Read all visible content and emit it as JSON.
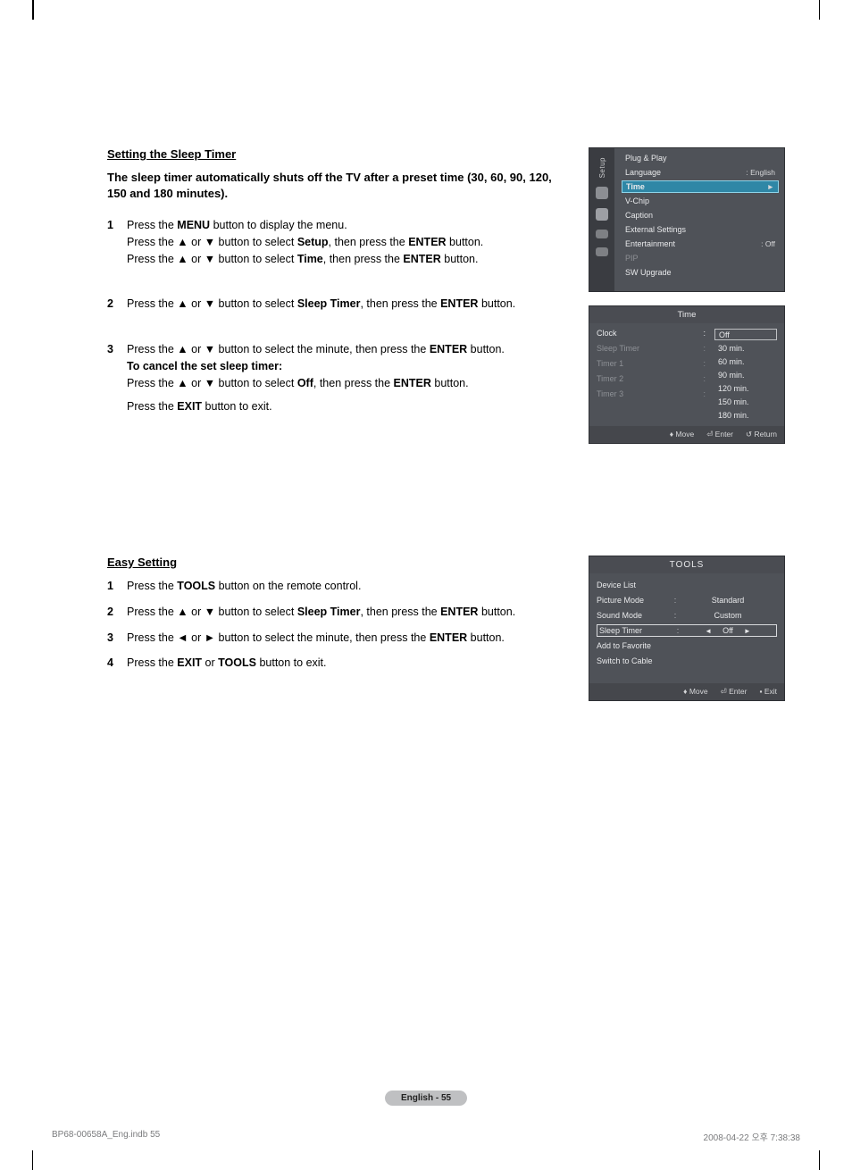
{
  "section1": {
    "heading": "Setting the Sleep Timer",
    "intro": "The sleep timer automatically shuts off the TV after a preset time (30, 60, 90, 120, 150 and 180 minutes).",
    "steps": [
      {
        "n": "1",
        "html": "Press the <b>MENU</b> button to display the menu.<br>Press the ▲ or ▼ button to select <b>Setup</b>, then press the <b>ENTER</b> button.<br>Press the ▲ or ▼ button to select <b>Time</b>, then press the <b>ENTER</b> button."
      },
      {
        "n": "2",
        "html": "Press the ▲ or ▼ button to select <b>Sleep Timer</b>, then press the <b>ENTER</b> button."
      },
      {
        "n": "3",
        "html": "Press the ▲ or ▼ button to select the minute, then press the <b>ENTER</b> button.<br><b>To cancel the set sleep timer:</b><br>Press the ▲ or ▼ button to select <b>Off</b>, then press the <b>ENTER</b> button.<br><span style='display:block;height:8px'></span>Press the <b>EXIT</b> button to exit."
      }
    ]
  },
  "section2": {
    "heading": "Easy Setting",
    "steps": [
      {
        "n": "1",
        "html": "Press the <b>TOOLS</b> button on the remote control."
      },
      {
        "n": "2",
        "html": "Press the ▲ or ▼ button to select <b>Sleep Timer</b>, then press the <b>ENTER</b> button."
      },
      {
        "n": "3",
        "html": "Press the ◄ or ► button to select the minute, then press the <b>ENTER</b> button."
      },
      {
        "n": "4",
        "html": "Press the <b>EXIT</b> or <b>TOOLS</b> button to exit."
      }
    ]
  },
  "osd_setup": {
    "rail_label": "Setup",
    "items": [
      {
        "k": "Plug & Play",
        "v": ""
      },
      {
        "k": "Language",
        "v": ": English"
      },
      {
        "k": "Time",
        "v": "►",
        "sel": true
      },
      {
        "k": "V-Chip",
        "v": ""
      },
      {
        "k": "Caption",
        "v": ""
      },
      {
        "k": "External Settings",
        "v": ""
      },
      {
        "k": "Entertainment",
        "v": ": Off"
      },
      {
        "k": "PIP",
        "v": "",
        "dim": true
      },
      {
        "k": "SW Upgrade",
        "v": ""
      }
    ]
  },
  "osd_time": {
    "title": "Time",
    "left": [
      {
        "k": "Clock",
        "v": ":",
        "on": true
      },
      {
        "k": "Sleep Timer",
        "v": ":"
      },
      {
        "k": "Timer 1",
        "v": ":"
      },
      {
        "k": "Timer 2",
        "v": ":"
      },
      {
        "k": "Timer 3",
        "v": ":"
      }
    ],
    "options": [
      "Off",
      "30 min.",
      "60 min.",
      "90 min.",
      "120 min.",
      "150 min.",
      "180 min."
    ],
    "foot": {
      "move": "Move",
      "enter": "Enter",
      "return": "Return"
    }
  },
  "osd_tools": {
    "title": "TOOLS",
    "rows": [
      {
        "k": "Device List",
        "type": "plain"
      },
      {
        "k": "Picture Mode",
        "v": "Standard"
      },
      {
        "k": "Sound Mode",
        "v": "Custom"
      },
      {
        "k": "Sleep Timer",
        "v": "Off",
        "sel": true
      },
      {
        "k": "Add to Favorite",
        "type": "plain"
      },
      {
        "k": "Switch to Cable",
        "type": "plain"
      }
    ],
    "foot": {
      "move": "Move",
      "enter": "Enter",
      "exit": "Exit"
    }
  },
  "pager": "English - 55",
  "docfoot": {
    "left": "BP68-00658A_Eng.indb   55",
    "right": "2008-04-22   오후 7:38:38"
  }
}
